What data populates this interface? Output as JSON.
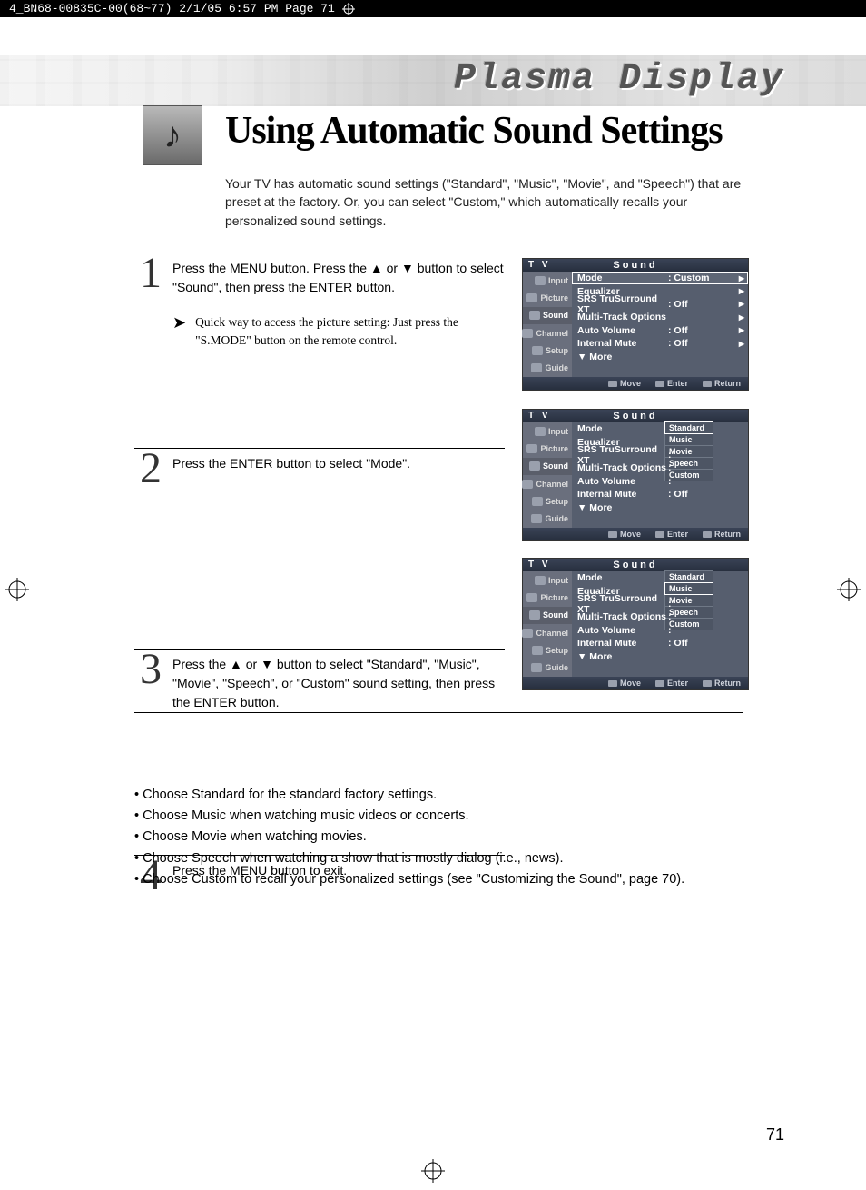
{
  "print_header": "4_BN68-00835C-00(68~77)  2/1/05  6:57 PM  Page 71",
  "brand_title": "Plasma Display",
  "page_title": "Using Automatic Sound Settings",
  "intro": "Your TV has automatic sound settings (\"Standard\", \"Music\", \"Movie\", and \"Speech\") that are preset at the factory. Or, you can select \"Custom,\" which automatically recalls your personalized sound settings.",
  "steps": [
    {
      "num": "1",
      "body": "Press the MENU button. Press the ▲ or ▼ button to select \"Sound\", then press the ENTER button.",
      "tip": "Quick way to access the picture setting: Just press the \"S.MODE\" button on the remote control."
    },
    {
      "num": "2",
      "body": "Press the ENTER button to select \"Mode\"."
    },
    {
      "num": "3",
      "body": "Press the ▲ or ▼ button to select \"Standard\", \"Music\", \"Movie\", \"Speech\", or \"Custom\" sound setting, then press the ENTER button."
    },
    {
      "num": "4",
      "body": "Press the MENU button to exit."
    }
  ],
  "bullets": [
    "Choose Standard for the standard factory settings.",
    "Choose Music when watching music videos or concerts.",
    "Choose Movie when watching movies.",
    "Choose Speech when watching a show that is mostly dialog (i.e., news).",
    "Choose Custom to recall your personalized settings (see \"Customizing the Sound\", page 70)."
  ],
  "page_number": "71",
  "osd": {
    "tv_label": "T V",
    "title": "Sound",
    "side": [
      "Input",
      "Picture",
      "Sound",
      "Channel",
      "Setup",
      "Guide"
    ],
    "rows": {
      "mode": "Mode",
      "equalizer": "Equalizer",
      "srs": "SRS TruSurround XT",
      "multi": "Multi-Track Options",
      "autovol": "Auto Volume",
      "intmute": "Internal Mute",
      "more": "▼ More"
    },
    "values": {
      "custom": ": Custom",
      "off": ": Off",
      "colon": ":"
    },
    "options": [
      "Standard",
      "Music",
      "Movie",
      "Speech",
      "Custom"
    ],
    "footer": {
      "move": "Move",
      "enter": "Enter",
      "return": "Return"
    }
  }
}
